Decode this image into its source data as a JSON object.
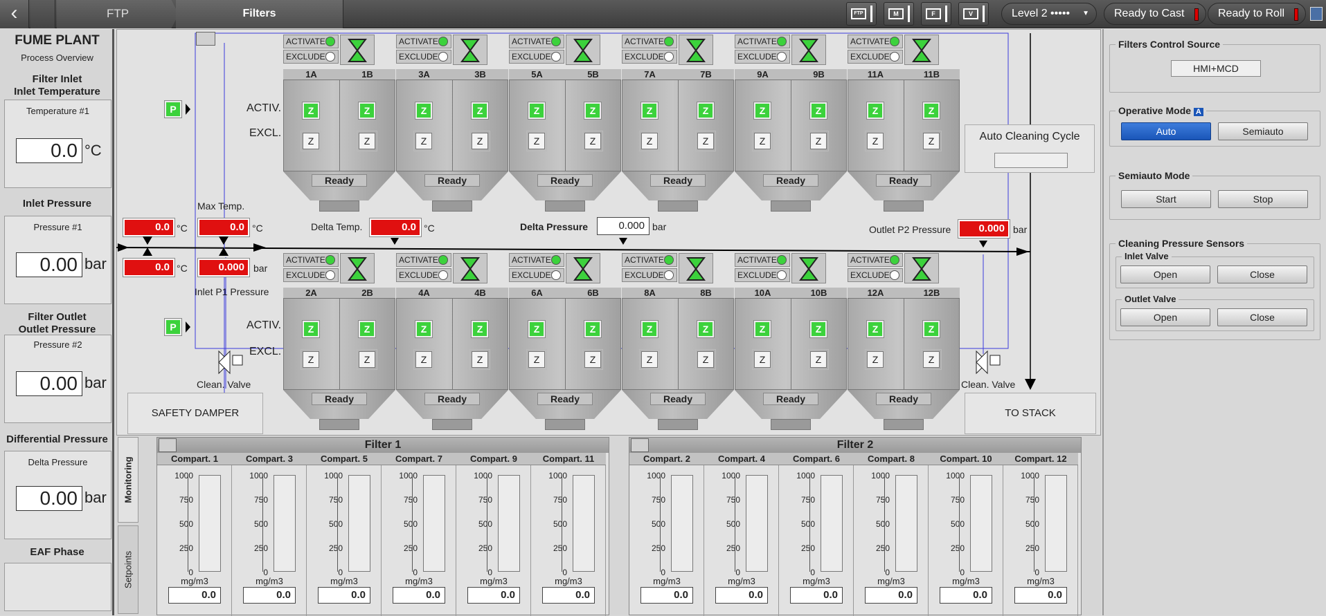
{
  "topbar": {
    "back_icon": "chevron-left-icon",
    "crumb_ftp": "FTP",
    "crumb_filters": "Filters",
    "tool_buttons": [
      {
        "glyph": "FTP"
      },
      {
        "glyph": "M"
      },
      {
        "glyph": "F"
      },
      {
        "glyph": "V"
      }
    ],
    "level": "Level 2 •••••",
    "ready_cast": "Ready to Cast",
    "ready_roll": "Ready to Roll"
  },
  "left": {
    "title": "FUME PLANT",
    "subtitle": "Process Overview",
    "inlet_section": "Filter Inlet",
    "inlet_temp_title": "Inlet Temperature",
    "temp_label": "Temperature #1",
    "temp_value": "0.0",
    "temp_unit": "°C",
    "inlet_pressure_title": "Inlet Pressure",
    "pressure1_label": "Pressure #1",
    "pressure1_value": "0.00",
    "pressure_unit": "bar",
    "outlet_section": "Filter Outlet",
    "outlet_pressure_title": "Outlet Pressure",
    "pressure2_label": "Pressure #2",
    "pressure2_value": "0.00",
    "diff_title": "Differential Pressure",
    "delta_label": "Delta Pressure",
    "delta_value": "0.00",
    "eaf_title": "EAF Phase"
  },
  "diagram": {
    "activated": "ACTIVATED",
    "excluded": "EXCLUDED",
    "activ": "ACTIV.",
    "excl": "EXCL.",
    "ready": "Ready",
    "z": "Z",
    "p": "P",
    "top_compartments": [
      "1A",
      "1B",
      "3A",
      "3B",
      "5A",
      "5B",
      "7A",
      "7B",
      "9A",
      "9B",
      "11A",
      "11B"
    ],
    "bottom_compartments": [
      "2A",
      "2B",
      "4A",
      "4B",
      "6A",
      "6B",
      "8A",
      "8B",
      "10A",
      "10B",
      "12A",
      "12B"
    ],
    "auto_cleaning": "Auto Cleaning Cycle",
    "max_temp": "Max Temp.",
    "delta_temp": "Delta Temp.",
    "delta_pressure": "Delta Pressure",
    "outlet_p2": "Outlet P2 Pressure",
    "inlet_p1": "Inlet P1 Pressure",
    "val_temp_a": "0.0",
    "val_temp_b": "0.0",
    "val_max_temp": "0.0",
    "val_p1": "0.000",
    "val_delta_temp": "0.0",
    "val_delta_p": "0.000",
    "val_p2": "0.000",
    "unit_c": "°C",
    "unit_bar": "bar",
    "clean_valve": "Clean. Valve",
    "safety_damper": "SAFETY DAMPER",
    "to_stack": "TO STACK"
  },
  "right": {
    "filters_source_title": "Filters Control Source",
    "source_value": "HMI+MCD",
    "operative_title": "Operative Mode",
    "operative_badge": "A",
    "auto": "Auto",
    "semiauto": "Semiauto",
    "semiauto_title": "Semiauto Mode",
    "start": "Start",
    "stop": "Stop",
    "sensors_title": "Cleaning Pressure Sensors",
    "inlet_valve": "Inlet Valve",
    "outlet_valve": "Outlet Valve",
    "open": "Open",
    "close": "Close"
  },
  "monitoring": {
    "tab_monitoring": "Monitoring",
    "tab_setpoints": "Setpoints",
    "filter1": "Filter 1",
    "filter2": "Filter 2",
    "unit": "mg/m3",
    "ticks": [
      "1000",
      "750",
      "500",
      "250",
      "0"
    ],
    "f1_cols": [
      {
        "name": "Compart. 1",
        "value": "0.0"
      },
      {
        "name": "Compart. 3",
        "value": "0.0"
      },
      {
        "name": "Compart. 5",
        "value": "0.0"
      },
      {
        "name": "Compart. 7",
        "value": "0.0"
      },
      {
        "name": "Compart. 9",
        "value": "0.0"
      },
      {
        "name": "Compart. 11",
        "value": "0.0"
      }
    ],
    "f2_cols": [
      {
        "name": "Compart. 2",
        "value": "0.0"
      },
      {
        "name": "Compart. 4",
        "value": "0.0"
      },
      {
        "name": "Compart. 6",
        "value": "0.0"
      },
      {
        "name": "Compart. 8",
        "value": "0.0"
      },
      {
        "name": "Compart. 10",
        "value": "0.0"
      },
      {
        "name": "Compart. 12",
        "value": "0.0"
      }
    ]
  }
}
